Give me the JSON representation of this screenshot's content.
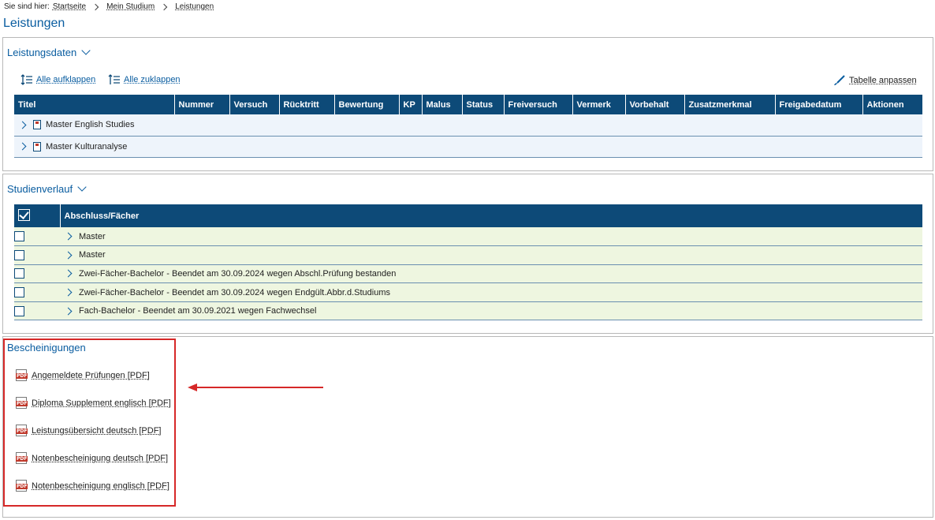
{
  "breadcrumb": {
    "prefix": "Sie sind hier:",
    "items": [
      "Startseite",
      "Mein Studium",
      "Leistungen"
    ]
  },
  "page_title": "Leistungen",
  "performance": {
    "title": "Leistungsdaten",
    "expand_all": "Alle aufklappen",
    "collapse_all": "Alle zuklappen",
    "customize_table": "Tabelle anpassen",
    "columns": [
      "Titel",
      "Nummer",
      "Versuch",
      "Rücktritt",
      "Bewertung",
      "KP",
      "Malus",
      "Status",
      "Freiversuch",
      "Vermerk",
      "Vorbehalt",
      "Zusatzmerkmal",
      "Freigabedatum",
      "Aktionen"
    ],
    "rows": [
      "Master English Studies",
      "Master Kulturanalyse"
    ]
  },
  "study_progress": {
    "title": "Studienverlauf",
    "column": "Abschluss/Fächer",
    "rows": [
      "Master",
      "Master",
      "Zwei-Fächer-Bachelor - Beendet am 30.09.2024 wegen Abschl.Prüfung bestanden",
      "Zwei-Fächer-Bachelor - Beendet am 30.09.2024 wegen Endgült.Abbr.d.Studiums",
      "Fach-Bachelor - Beendet am 30.09.2021 wegen Fachwechsel"
    ]
  },
  "certificates": {
    "title": "Bescheinigungen",
    "pdf_badge": "PDF",
    "items": [
      "Angemeldete Prüfungen [PDF]",
      "Diploma Supplement englisch [PDF]",
      "Leistungsübersicht deutsch [PDF]",
      "Notenbescheinigung deutsch [PDF]",
      "Notenbescheinigung englisch [PDF]"
    ]
  },
  "colors": {
    "accent": "#0a5da0",
    "header_bg": "#0d4a78",
    "highlight": "#d62828"
  }
}
